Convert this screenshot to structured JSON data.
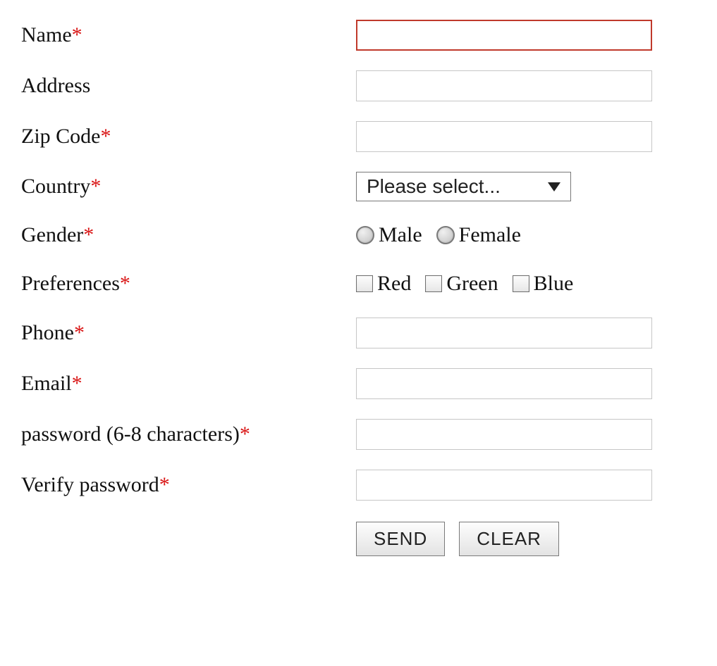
{
  "labels": {
    "name": "Name",
    "address": "Address",
    "zip": "Zip Code",
    "country": "Country",
    "gender": "Gender",
    "preferences": "Preferences",
    "phone": "Phone",
    "email": "Email",
    "password": "password (6-8 characters)",
    "verify": "Verify password"
  },
  "required_marker": "*",
  "country_select": {
    "selected": "Please select..."
  },
  "gender": {
    "options": {
      "male": "Male",
      "female": "Female"
    }
  },
  "preferences": {
    "options": {
      "red": "Red",
      "green": "Green",
      "blue": "Blue"
    }
  },
  "buttons": {
    "send": "SEND",
    "clear": "CLEAR"
  }
}
